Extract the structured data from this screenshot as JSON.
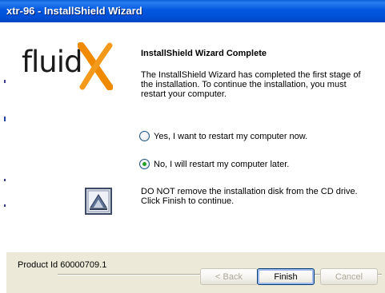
{
  "window": {
    "title": "xtr-96 - InstallShield Wizard"
  },
  "logo": {
    "text": "fluid",
    "mark": "X"
  },
  "main": {
    "heading": "InstallShield Wizard Complete",
    "description": "The InstallShield Wizard has completed the first stage of the installation. To continue the installation, you must restart your computer.",
    "options": [
      {
        "label": "Yes, I want to restart my computer now.",
        "selected": false
      },
      {
        "label": "No, I will restart my computer later.",
        "selected": true
      }
    ],
    "notice": "DO NOT remove the installation disk from the CD drive. Click Finish to continue."
  },
  "footer": {
    "product_id": "Product Id 60000709.1",
    "back_label": "< Back",
    "finish_label": "Finish",
    "cancel_label": "Cancel"
  },
  "colors": {
    "titlebar": "#0058e0",
    "logo_x": "#f08a00",
    "dialog_bg": "#ece9d8"
  }
}
